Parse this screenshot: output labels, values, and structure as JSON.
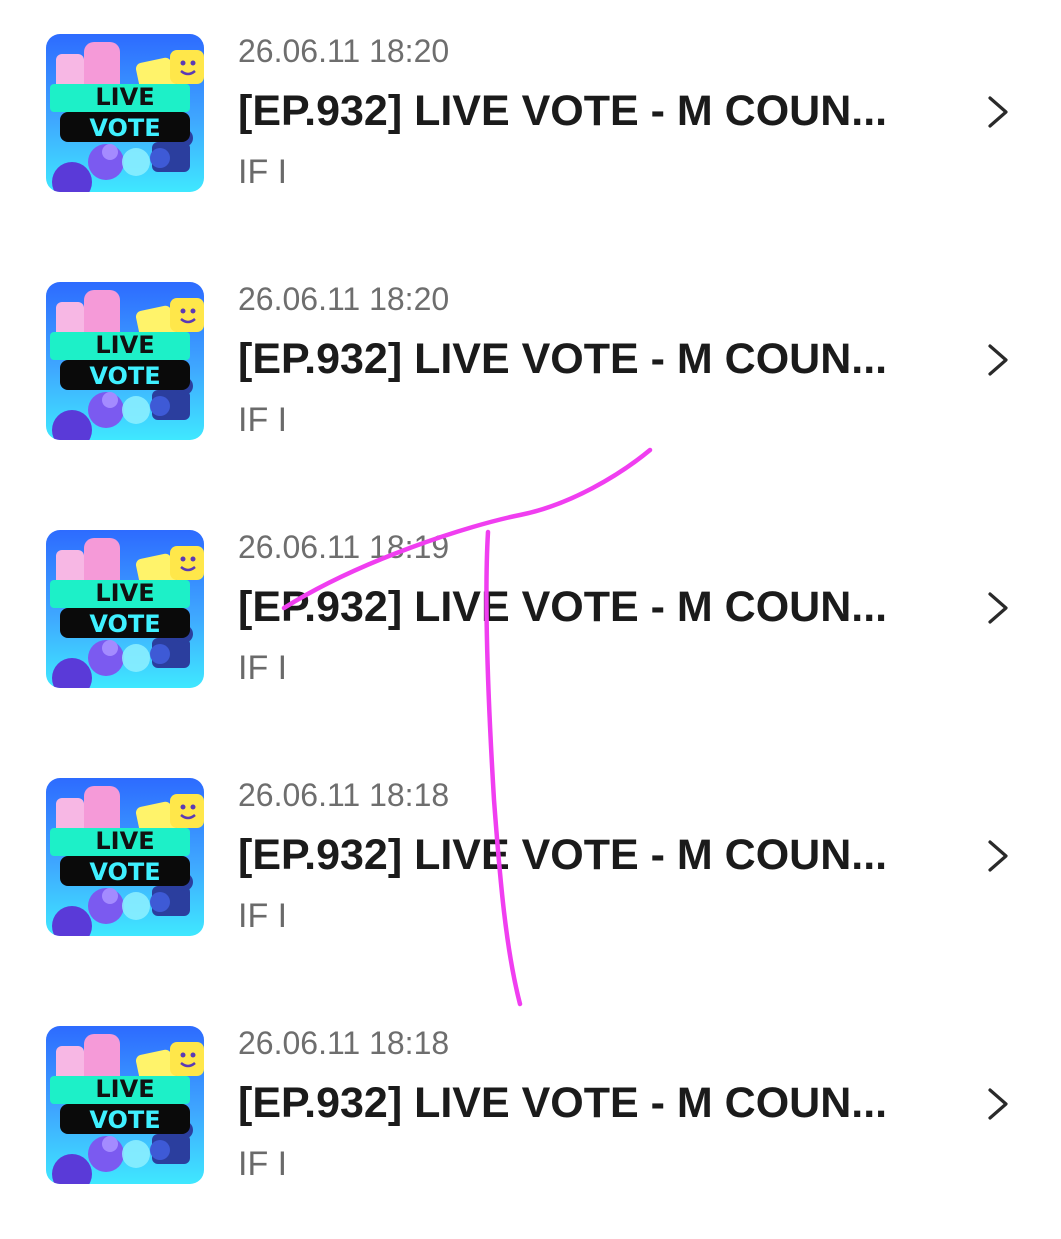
{
  "items": [
    {
      "date": "26.06.11 18:20",
      "title": "[EP.932] LIVE VOTE - M COUN...",
      "artist": "IF I",
      "thumbnail": {
        "line1": "LIVE",
        "line2": "VOTE"
      }
    },
    {
      "date": "26.06.11 18:20",
      "title": "[EP.932] LIVE VOTE - M COUN...",
      "artist": "IF I",
      "thumbnail": {
        "line1": "LIVE",
        "line2": "VOTE"
      }
    },
    {
      "date": "26.06.11 18:19",
      "title": "[EP.932] LIVE VOTE - M COUN...",
      "artist": "IF I",
      "thumbnail": {
        "line1": "LIVE",
        "line2": "VOTE"
      }
    },
    {
      "date": "26.06.11 18:18",
      "title": "[EP.932] LIVE VOTE - M COUN...",
      "artist": "IF I",
      "thumbnail": {
        "line1": "LIVE",
        "line2": "VOTE"
      }
    },
    {
      "date": "26.06.11 18:18",
      "title": "[EP.932] LIVE VOTE - M COUN...",
      "artist": "IF I",
      "thumbnail": {
        "line1": "LIVE",
        "line2": "VOTE"
      }
    }
  ],
  "icons": {
    "row_action": "chevron-right-icon"
  },
  "colors": {
    "date_text": "#6e6e6e",
    "title_text": "#1b1b1b",
    "artist_text": "#6a6a6a",
    "thumbnail_bg_top": "#2d6bff",
    "thumbnail_bg_bottom": "#3fe8ff",
    "thumbnail_banner": "#1df0c8",
    "scribble": "#f03ef0"
  }
}
